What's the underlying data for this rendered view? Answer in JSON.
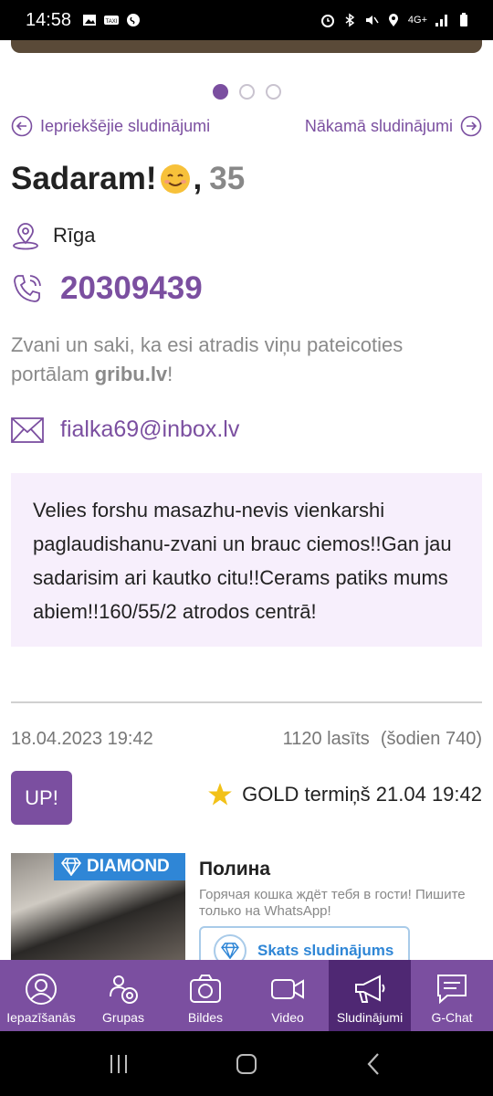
{
  "status_bar": {
    "time": "14:58",
    "left_icons": [
      "image-icon",
      "taxi-icon",
      "shazam-icon"
    ],
    "right_icons": [
      "alarm-icon",
      "bluetooth-icon",
      "mute-icon",
      "location-icon",
      "network-icon",
      "signal-icon",
      "battery-icon"
    ],
    "network_label": "4G+"
  },
  "carousel": {
    "dot_count": 3,
    "active_index": 0
  },
  "navigation": {
    "prev_label": "Iepriekšējie sludinājumi",
    "next_label": "Nākamā sludinājumi"
  },
  "profile": {
    "name": "Sadaram!",
    "emoji": "smiling-face-icon",
    "separator": ",",
    "age": "35",
    "city": "Rīga",
    "phone": "20309439",
    "hint_text": "Zvani un saki, ka esi atradis viņu pateicoties portālam ",
    "hint_site": "gribu.lv",
    "hint_end": "!",
    "email": "fialka69@inbox.lv"
  },
  "description": "Velies forshu masazhu-nevis vienkarshi paglaudishanu-zvani un brauc ciemos!!Gan jau sadarisim ari kautko citu!!Cerams patiks mums abiem!!160/55/2 atrodos centrā!",
  "meta": {
    "date": "18.04.2023 19:42",
    "views": "1120 lasīts",
    "today": "(šodien 740)"
  },
  "up_button": "UP!",
  "gold": {
    "label": "GOLD termiņš 21.04 19:42"
  },
  "promo_card": {
    "badge": "DIAMOND",
    "name": "Полина",
    "text": "Горячая кошка ждёт тебя в гости! Пишите только на WhatsApp!",
    "button": "Skats sludinājums"
  },
  "tabs": [
    {
      "label": "Iepazīšanās",
      "icon": "user-icon",
      "active": false
    },
    {
      "label": "Grupas",
      "icon": "groups-icon",
      "active": false
    },
    {
      "label": "Bildes",
      "icon": "camera-icon",
      "active": false
    },
    {
      "label": "Video",
      "icon": "video-icon",
      "active": false
    },
    {
      "label": "Sludinājumi",
      "icon": "megaphone-icon",
      "active": true
    },
    {
      "label": "G-Chat",
      "icon": "chat-icon",
      "active": false
    }
  ],
  "colors": {
    "accent": "#7b4fa0",
    "accent_dark": "#4f2873",
    "desc_bg": "#f7effc",
    "diamond_blue": "#2f86d6",
    "star": "#f2c118"
  }
}
